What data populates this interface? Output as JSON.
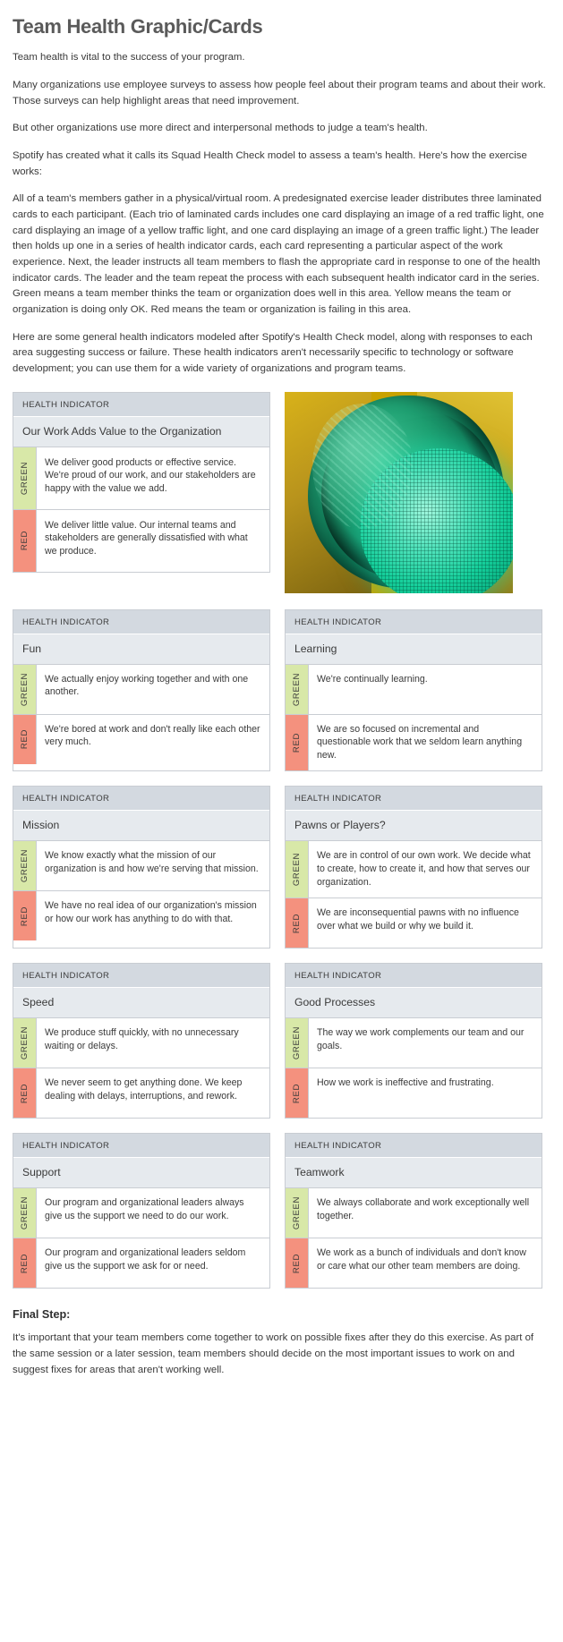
{
  "page_title": "Team Health Graphic/Cards",
  "intro_paragraphs": [
    "Team health is vital to the success of your program.",
    "Many organizations use employee surveys to assess how people feel about their program teams and about their work. Those surveys can help highlight areas that need improvement.",
    "But other organizations use more direct and interpersonal methods to judge a team's health.",
    "Spotify has created what it calls its Squad Health Check model to assess a team's health. Here's how the exercise works:",
    "All of a team's members gather in a physical/virtual room. A predesignated exercise leader distributes three laminated cards to each participant. (Each trio of laminated cards includes one card displaying an image of a red traffic light, one card displaying an image of a yellow traffic light, and one card displaying an image of a green traffic light.) The leader then holds up one in a series of health indicator cards, each card representing a particular aspect of the work experience. Next, the leader instructs all team members to flash the appropriate card in response to one of the health indicator cards. The leader and the team repeat the process with each subsequent health indicator card in the series. Green means a team member thinks the team or organization does well in this area. Yellow means the team or organization is doing only OK. Red means the team or organization is failing in this area.",
    "Here are some general health indicators modeled after Spotify's Health Check model, along with responses to each area suggesting success or failure. These health indicators aren't necessarily specific to technology or software development; you can use them for a wide variety of organizations and program teams."
  ],
  "card_header_label": "HEALTH INDICATOR",
  "green_label": "GREEN",
  "red_label": "RED",
  "photo": {
    "icon": "green-traffic-light-photo",
    "alt": "Close-up photograph of an illuminated green traffic light in a yellow housing"
  },
  "colors": {
    "header_bg": "#d3d9e0",
    "title_bg": "#e6eaee",
    "green_tab": "#d8e8a8",
    "red_tab": "#f4917e",
    "border": "#c9cdd3",
    "heading_text": "#5a5a5a",
    "body_text": "#3a3a3a"
  },
  "cards": [
    {
      "title": "Our Work Adds Value to the Organization",
      "green": "We deliver good products or effective service. We're proud of our work, and our stakeholders are happy with the value we add.",
      "red": "We deliver little value. Our internal teams and stakeholders are generally dissatisfied with what we produce."
    },
    {
      "title": "Fun",
      "green": "We actually enjoy working together and with one another.",
      "red": "We're bored at work and don't really like each other very much."
    },
    {
      "title": "Learning",
      "green": "We're continually learning.",
      "red": "We are so focused on incremental and questionable work that we seldom learn anything new."
    },
    {
      "title": "Mission",
      "green": "We know exactly what the mission of our organization is and how we're serving that mission.",
      "red": "We have no real idea of our organization's mission or how our work has anything to do with that."
    },
    {
      "title": "Pawns or Players?",
      "green": "We are in control of our own work. We decide what to create, how to create it, and how that serves our organization.",
      "red": "We are inconsequential pawns with no influence over what we build or why we build it."
    },
    {
      "title": "Speed",
      "green": "We produce stuff quickly, with no unnecessary waiting or delays.",
      "red": "We never seem to get anything done. We keep dealing with delays, interruptions, and rework."
    },
    {
      "title": "Good Processes",
      "green": "The way we work complements our team and our goals.",
      "red": "How we work is ineffective and frustrating."
    },
    {
      "title": "Support",
      "green": "Our program and organizational leaders always give us the support we need to do our work.",
      "red": "Our program and organizational leaders seldom give us the support we ask for or need."
    },
    {
      "title": "Teamwork",
      "green": "We always collaborate and work exceptionally well together.",
      "red": "We work as a bunch of individuals and don't know or care what our other team members are doing."
    }
  ],
  "final": {
    "heading": "Final Step:",
    "paragraph": "It's important that your team members come together to work on possible fixes after they do this exercise. As part of the same session or a later session, team members should decide on the most important issues to work on and suggest fixes for areas that aren't working well."
  }
}
